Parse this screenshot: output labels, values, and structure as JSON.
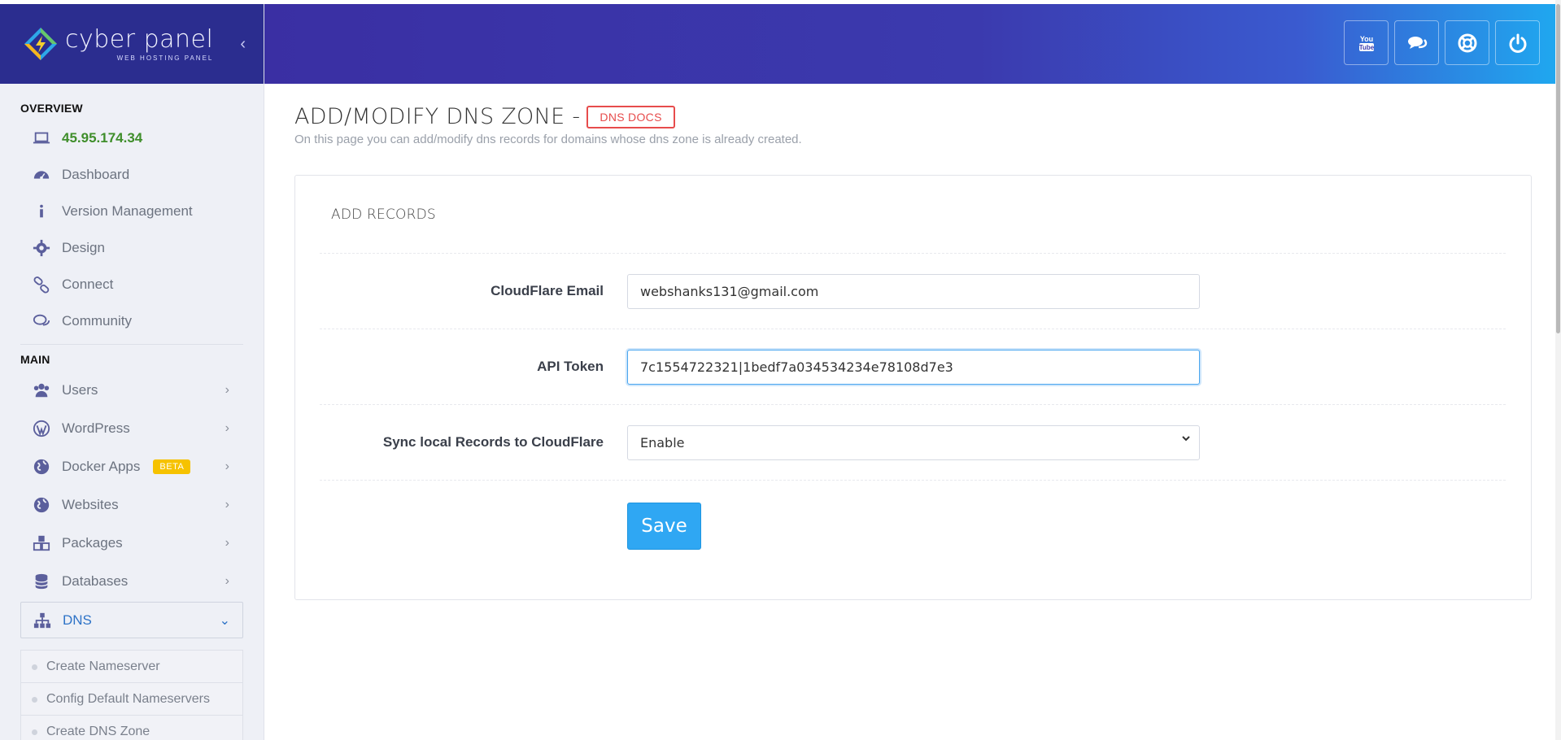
{
  "brand": {
    "name": "cyber panel",
    "subtitle": "WEB HOSTING PANEL"
  },
  "sidebar": {
    "overview_title": "OVERVIEW",
    "ip_address": "45.95.174.34",
    "overview_items": [
      {
        "label": "Dashboard",
        "icon": "dashboard-icon"
      },
      {
        "label": "Version Management",
        "icon": "info-icon"
      },
      {
        "label": "Design",
        "icon": "gear-icon"
      },
      {
        "label": "Connect",
        "icon": "link-icon"
      },
      {
        "label": "Community",
        "icon": "chat-icon"
      }
    ],
    "main_title": "MAIN",
    "main_items": [
      {
        "label": "Users",
        "icon": "users-icon"
      },
      {
        "label": "WordPress",
        "icon": "wordpress-icon"
      },
      {
        "label": "Docker Apps",
        "icon": "globe-icon",
        "badge": "BETA"
      },
      {
        "label": "Websites",
        "icon": "globe-icon"
      },
      {
        "label": "Packages",
        "icon": "cubes-icon"
      },
      {
        "label": "Databases",
        "icon": "database-icon"
      },
      {
        "label": "DNS",
        "icon": "sitemap-icon"
      }
    ],
    "dns_subitems": [
      "Create Nameserver",
      "Config Default Nameservers",
      "Create DNS Zone"
    ]
  },
  "header": {
    "buttons": [
      "youtube-icon",
      "chat-icon",
      "lifebuoy-icon",
      "power-icon"
    ]
  },
  "page": {
    "title": "ADD/MODIFY DNS ZONE -",
    "docs_label": "DNS DOCS",
    "description": "On this page you can add/modify dns records for domains whose dns zone is already created."
  },
  "form": {
    "panel_title": "ADD RECORDS",
    "email_label": "CloudFlare Email",
    "email_value": "webshanks131@gmail.com",
    "token_label": "API Token",
    "token_value": "7c1554722321|1bedf7a034534234e78108d7e3",
    "sync_label": "Sync local Records to CloudFlare",
    "sync_value": "Enable",
    "save_label": "Save"
  },
  "colors": {
    "header_gradient_start": "#3a2fa3",
    "header_gradient_end": "#1fa9f0",
    "accent_blue": "#2fa7f3",
    "ip_green": "#3f8e2b",
    "docs_red": "#e74c4c",
    "badge_yellow": "#f6c200"
  }
}
